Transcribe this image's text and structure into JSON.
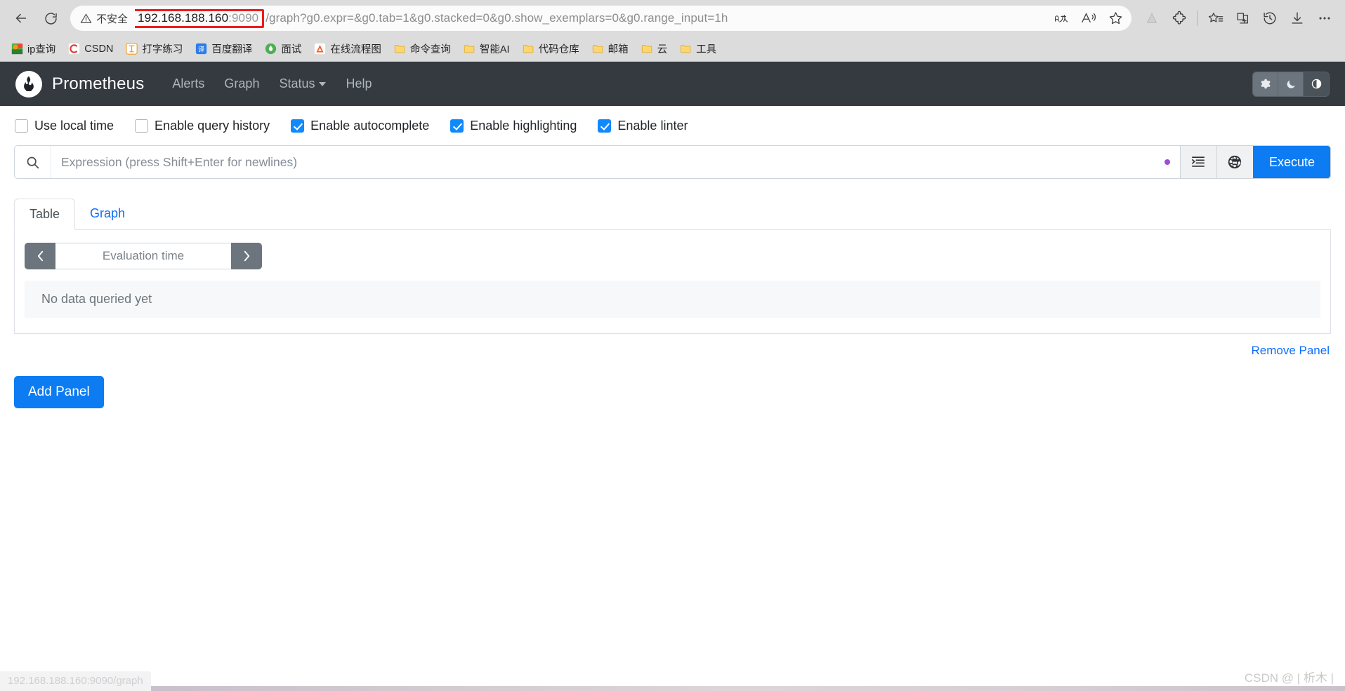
{
  "browser": {
    "back_label": "Back",
    "refresh_label": "Refresh",
    "security_label": "不安全",
    "url_host": "192.168.188.160",
    "url_port": ":9090",
    "url_path": "/graph?g0.expr=&g0.tab=1&g0.stacked=0&g0.show_exemplars=0&g0.range_input=1h",
    "url_full": "192.168.188.160:9090/graph?g0.expr=&g0.tab=1&g0.stacked=0&g0.show_exemplars=0&g0.range_input=1h",
    "urlbar_icons": [
      {
        "name": "translate-icon",
        "glyph": "aあ"
      },
      {
        "name": "read-aloud-icon",
        "glyph": "A"
      },
      {
        "name": "favorite-star-icon",
        "glyph": "☆"
      }
    ],
    "right_icons": [
      {
        "name": "browser-essentials-icon"
      },
      {
        "name": "extensions-icon"
      },
      {
        "name": "favorites-list-icon"
      },
      {
        "name": "collections-icon"
      },
      {
        "name": "history-icon"
      },
      {
        "name": "downloads-icon"
      },
      {
        "name": "settings-more-icon"
      }
    ],
    "bookmarks": [
      {
        "label": "ip查询",
        "icon": "ip-lookup-icon"
      },
      {
        "label": "CSDN",
        "icon": "csdn-icon"
      },
      {
        "label": "打字练习",
        "icon": "typing-practice-icon"
      },
      {
        "label": "百度翻译",
        "icon": "baidu-translate-icon"
      },
      {
        "label": "面试",
        "icon": "interview-icon"
      },
      {
        "label": "在线流程图",
        "icon": "flowchart-icon"
      },
      {
        "label": "命令查询",
        "icon": "folder-icon"
      },
      {
        "label": "智能AI",
        "icon": "folder-icon"
      },
      {
        "label": "代码仓库",
        "icon": "folder-icon"
      },
      {
        "label": "邮箱",
        "icon": "folder-icon"
      },
      {
        "label": "云",
        "icon": "folder-icon"
      },
      {
        "label": "工具",
        "icon": "folder-icon"
      }
    ]
  },
  "navbar": {
    "brand": "Prometheus",
    "logo_name": "prometheus-logo",
    "links": [
      {
        "label": "Alerts",
        "name": "nav-alerts"
      },
      {
        "label": "Graph",
        "name": "nav-graph"
      },
      {
        "label": "Status",
        "name": "nav-status",
        "has_caret": true
      },
      {
        "label": "Help",
        "name": "nav-help"
      }
    ],
    "theme_buttons": [
      {
        "name": "theme-light-gear-icon",
        "active": false
      },
      {
        "name": "theme-dark-moon-icon",
        "active": false
      },
      {
        "name": "theme-auto-contrast-icon",
        "active": true
      }
    ]
  },
  "options": [
    {
      "label": "Use local time",
      "checked": false,
      "name": "use-local-time"
    },
    {
      "label": "Enable query history",
      "checked": false,
      "name": "enable-query-history"
    },
    {
      "label": "Enable autocomplete",
      "checked": true,
      "name": "enable-autocomplete"
    },
    {
      "label": "Enable highlighting",
      "checked": true,
      "name": "enable-highlighting"
    },
    {
      "label": "Enable linter",
      "checked": true,
      "name": "enable-linter"
    }
  ],
  "expression": {
    "placeholder": "Expression (press Shift+Enter for newlines)",
    "value": "",
    "status_dot_color": "#9a4fd6",
    "format_button_name": "format-expression-icon",
    "metrics_explorer_button_name": "metrics-explorer-globe-icon",
    "execute_label": "Execute"
  },
  "panel": {
    "tabs": [
      {
        "label": "Table",
        "active": true,
        "name": "tab-table"
      },
      {
        "label": "Graph",
        "active": false,
        "name": "tab-graph"
      }
    ],
    "eval_time_placeholder": "Evaluation time",
    "eval_prev_label": "‹",
    "eval_next_label": "›",
    "no_data_text": "No data queried yet",
    "remove_panel_label": "Remove Panel"
  },
  "add_panel_label": "Add Panel",
  "status_bar_text": "192.168.188.160:9090/graph",
  "watermark_text": "CSDN @ | 析木 |",
  "colors": {
    "navbar_bg": "#343a40",
    "accent_blue": "#0d7cf2",
    "link_blue": "#0d6efd",
    "checkbox_on": "#1089ff",
    "url_highlight_red": "#ef1c1c",
    "status_dot_purple": "#9a4fd6"
  }
}
